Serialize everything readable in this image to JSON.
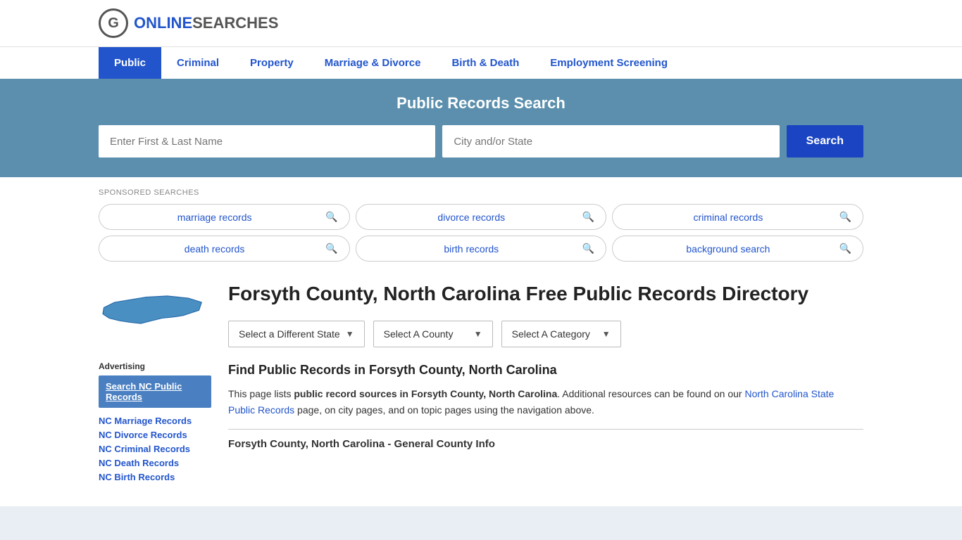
{
  "header": {
    "logo_online": "ONLINE",
    "logo_searches": "SEARCHES"
  },
  "nav": {
    "items": [
      {
        "label": "Public",
        "active": true
      },
      {
        "label": "Criminal",
        "active": false
      },
      {
        "label": "Property",
        "active": false
      },
      {
        "label": "Marriage & Divorce",
        "active": false
      },
      {
        "label": "Birth & Death",
        "active": false
      },
      {
        "label": "Employment Screening",
        "active": false
      }
    ]
  },
  "search_banner": {
    "title": "Public Records Search",
    "name_placeholder": "Enter First & Last Name",
    "location_placeholder": "City and/or State",
    "button_label": "Search"
  },
  "sponsored": {
    "label": "SPONSORED SEARCHES",
    "items": [
      {
        "label": "marriage records"
      },
      {
        "label": "divorce records"
      },
      {
        "label": "criminal records"
      },
      {
        "label": "death records"
      },
      {
        "label": "birth records"
      },
      {
        "label": "background search"
      }
    ]
  },
  "page_title": "Forsyth County, North Carolina Free Public Records Directory",
  "dropdowns": {
    "state": "Select a Different State",
    "county": "Select A County",
    "category": "Select A Category"
  },
  "find_title": "Find Public Records in Forsyth County, North Carolina",
  "description_part1": "This page lists ",
  "description_bold": "public record sources in Forsyth County, North Carolina",
  "description_part2": ". Additional resources can be found on our ",
  "description_link": "North Carolina State Public Records",
  "description_part3": " page, on city pages, and on topic pages using the navigation above.",
  "county_info_title": "Forsyth County, North Carolina - General County Info",
  "advertising_label": "Advertising",
  "ad_button_label": "Search NC Public Records",
  "sidebar_links": [
    {
      "label": "NC Marriage Records"
    },
    {
      "label": "NC Divorce Records"
    },
    {
      "label": "NC Criminal Records"
    },
    {
      "label": "NC Death Records"
    },
    {
      "label": "NC Birth Records"
    }
  ]
}
